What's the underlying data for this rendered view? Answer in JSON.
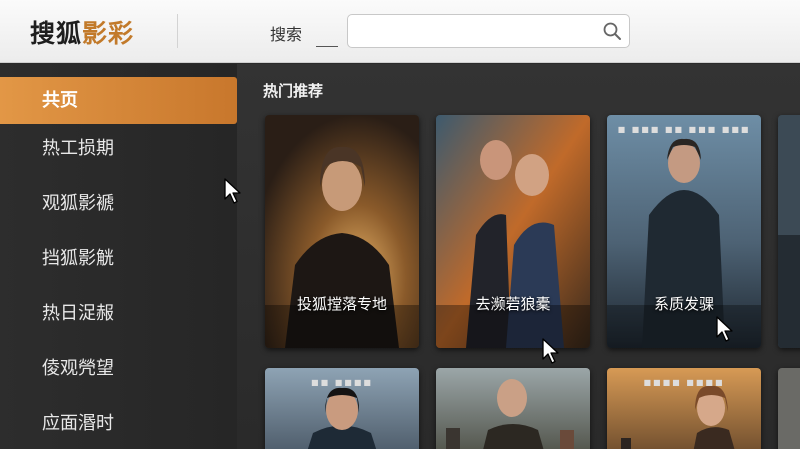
{
  "header": {
    "logo_part1": "搜狐",
    "logo_part2": "影彩",
    "search_label": "搜索",
    "search_value": ""
  },
  "sidebar": {
    "items": [
      {
        "label": "共页",
        "active": true
      },
      {
        "label": "热工损期",
        "active": false
      },
      {
        "label": "观狐影褫",
        "active": false
      },
      {
        "label": "挡狐影觥",
        "active": false
      },
      {
        "label": "热日浞赧",
        "active": false
      },
      {
        "label": "倰观焭望",
        "active": false
      },
      {
        "label": "应面湣时",
        "active": false
      }
    ]
  },
  "main": {
    "section_title": "热门推荐",
    "row1": [
      {
        "title": "投狐摚落专地",
        "top_text": ""
      },
      {
        "title": "去濒菪狼橐",
        "top_text": ""
      },
      {
        "title": "系质发骒",
        "top_text": "■ ■■■ ■■ ■■■ ■■■"
      },
      {
        "title": "",
        "top_text": ""
      }
    ],
    "row2": [
      {
        "title": "",
        "top_text": "■■ ■■■■"
      },
      {
        "title": "",
        "top_text": ""
      },
      {
        "title": "",
        "top_text": "■■■■ ■■■■"
      },
      {
        "title": "",
        "top_text": ""
      }
    ]
  },
  "colors": {
    "accent": "#d9883a",
    "sidebar_bg": "#2b2b2b",
    "header_bg": "#f4f4f4"
  }
}
